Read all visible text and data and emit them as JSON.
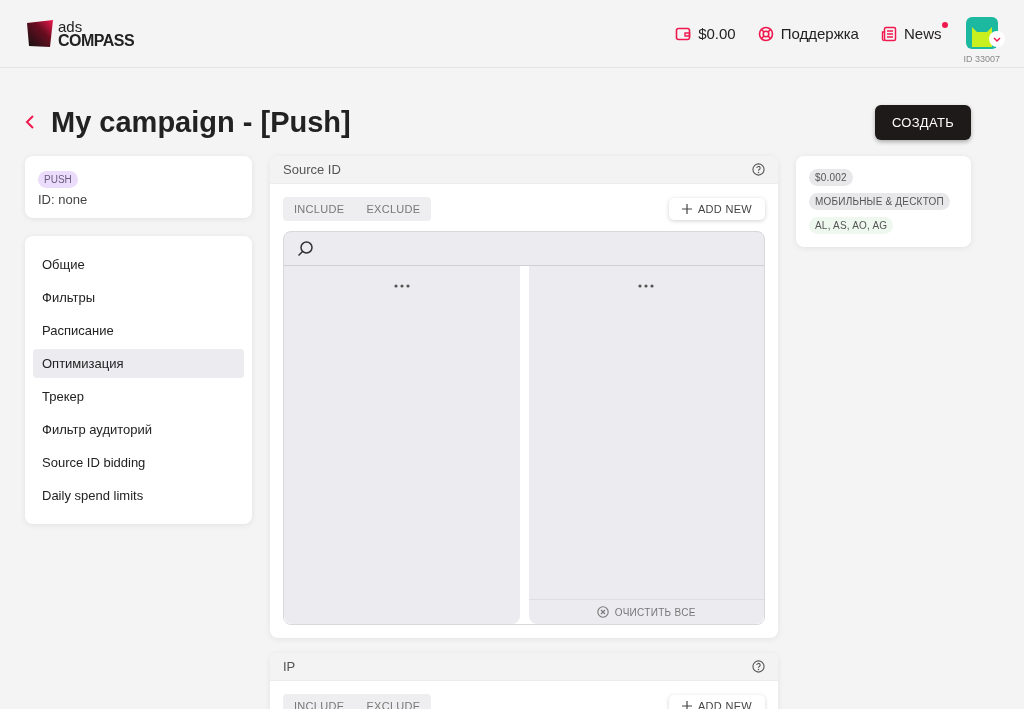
{
  "header": {
    "logo_top": "ads",
    "logo_bottom": "COMPASS",
    "balance": "$0.00",
    "support": "Поддержка",
    "news": "News",
    "news_unread": true,
    "user_id": "ID 33007"
  },
  "page": {
    "title": "My campaign - [Push]",
    "create_button": "СОЗДАТЬ"
  },
  "info_card": {
    "badge": "PUSH",
    "id_text": "ID: none"
  },
  "sidebar": {
    "items": [
      {
        "label": "Общие",
        "selected": false
      },
      {
        "label": "Фильтры",
        "selected": false
      },
      {
        "label": "Расписание",
        "selected": false
      },
      {
        "label": "Оптимизация",
        "selected": true
      },
      {
        "label": "Трекер",
        "selected": false
      },
      {
        "label": "Фильтр аудиторий",
        "selected": false
      },
      {
        "label": "Source ID bidding",
        "selected": false
      },
      {
        "label": "Daily spend limits",
        "selected": false
      }
    ]
  },
  "panels": [
    {
      "title": "Source ID",
      "tabs": [
        {
          "label": "INCLUDE",
          "selected": false
        },
        {
          "label": "EXCLUDE",
          "selected": false
        }
      ],
      "add_button": "ADD NEW",
      "clear_button": "ОЧИСТИТЬ ВСЕ"
    },
    {
      "title": "IP",
      "tabs": [
        {
          "label": "INCLUDE",
          "selected": false
        },
        {
          "label": "EXCLUDE",
          "selected": false
        }
      ],
      "add_button": "ADD NEW"
    }
  ],
  "summary": {
    "badges": [
      {
        "label": "$0.002",
        "color": "#e8e8ea"
      },
      {
        "label": "МОБИЛЬНЫЕ & ДЕСКТОП",
        "color": "#e8e8ea"
      },
      {
        "label": "AL, AS, AO, AG",
        "color": "#eef8ee"
      }
    ]
  }
}
